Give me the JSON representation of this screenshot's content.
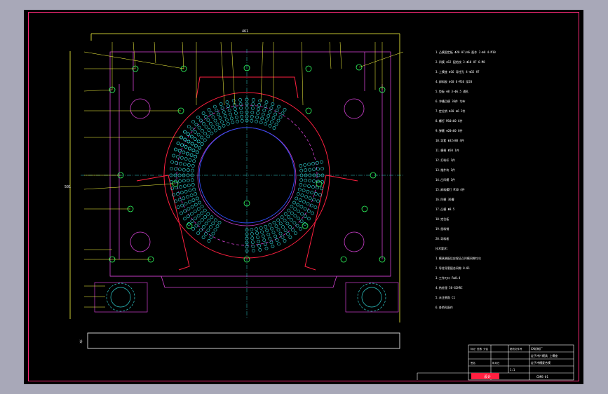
{
  "drawing": {
    "title_dim": "461",
    "side_dim": "501",
    "bottom_label": "计",
    "logo_text": "设计",
    "title_block": {
      "col_a": "标记 处数 分区",
      "col_b": "更改文件号",
      "col_c": "签名",
      "col_d": "年月日",
      "company": "XX机械厂",
      "part_name": "定子冲槽复合模",
      "part_sub": "定子冲片模具 上模座",
      "drawing_no": "CDMS-01",
      "scale": "1:1"
    },
    "spec_text_lines": [
      "1.凸模固定板 Φ20 H7/m6 配作  2-Φ8  4-M10",
      "2.凹模 Φ12  配钻铰  3-Φ10 H7  6-M8",
      "3.上模座  Φ16  导柱孔  4-Φ32 H7",
      "4.卸料板  Φ10  6-M10  深20",
      "5.垫板  Φ8  3-Φ6.5 通孔",
      "6.冲槽凸模 36件  均布",
      "7.定位销 Φ10 m6  2件",
      "8.螺钉 M10×60  6件",
      "9.弹簧 Φ20×60  8件",
      "10.导套 Φ32×80 4件",
      "11.模柄 Φ50  1件",
      "12.打料杆  1件",
      "13.推件块  1件",
      "14.凸凹模 1件",
      "15.卸料螺钉 M10 4件",
      "16.凹模 36槽",
      "17.凸模 Φ8.5",
      "18.定位板",
      "19.挡料销",
      "20.导料板",
      "技术要求:",
      "1.模具装配后应保证凸凹模间隙均匀",
      "2.导柱导套配合间隙 0.01",
      "3.工作刃口 Ra0.4",
      "4.热处理 58-62HRC",
      "5.未注倒角 C1",
      "6.各销孔配作"
    ]
  }
}
